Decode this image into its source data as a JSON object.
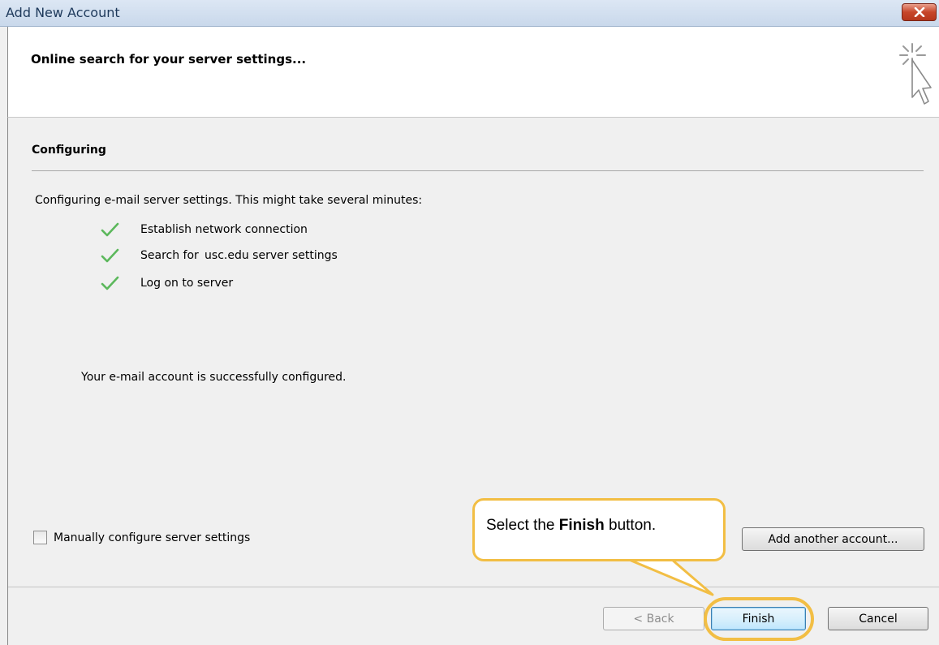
{
  "window": {
    "title": "Add New Account",
    "close_icon": "close-icon"
  },
  "header": {
    "heading": "Online search for your server settings...",
    "icon": "sparkle-cursor-icon"
  },
  "section": {
    "title": "Configuring",
    "intro": "Configuring e-mail server settings. This might take several minutes:",
    "steps": [
      {
        "label": "Establish network connection",
        "status": "done",
        "icon": "checkmark-icon"
      },
      {
        "label": "Search for  usc.edu server settings",
        "status": "done",
        "icon": "checkmark-icon"
      },
      {
        "label": "Log on to server",
        "status": "done",
        "icon": "checkmark-icon"
      }
    ],
    "success_message": "Your e-mail account is successfully configured."
  },
  "options": {
    "manual_config_label": "Manually configure server settings",
    "manual_config_checked": false
  },
  "buttons": {
    "add_another": "Add another account...",
    "back": "< Back",
    "finish": "Finish",
    "cancel": "Cancel"
  },
  "callout": {
    "prefix": "Select the ",
    "emphasis": "Finish",
    "suffix": " button."
  },
  "colors": {
    "check": "#5cb85c",
    "highlight": "#f2be44",
    "close_button": "#c7462a"
  }
}
